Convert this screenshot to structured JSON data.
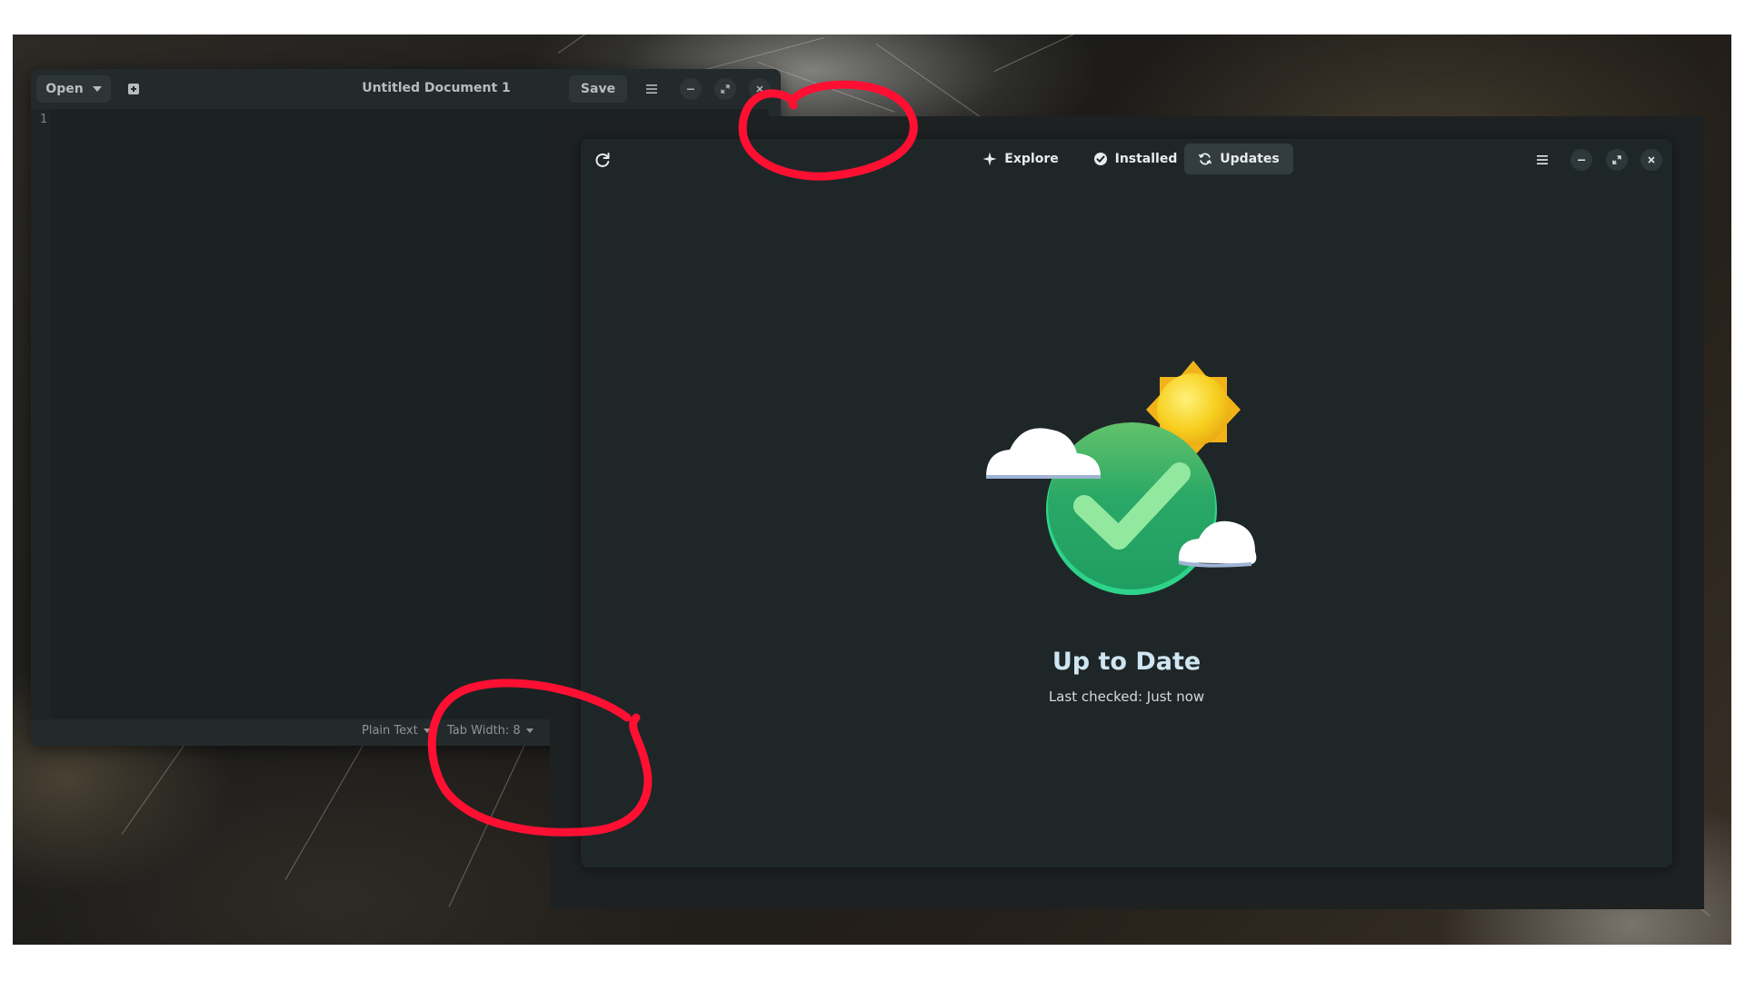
{
  "editor": {
    "open_label": "Open",
    "title": "Untitled Document 1",
    "save_label": "Save",
    "line_number": "1",
    "language": "Plain Text",
    "tab_width": "Tab Width: 8"
  },
  "updater": {
    "tabs": [
      {
        "label": "Explore",
        "icon": "sparkle-icon"
      },
      {
        "label": "Installed",
        "icon": "check-circle-icon"
      },
      {
        "label": "Updates",
        "icon": "sync-icon",
        "active": true
      }
    ],
    "status_title": "Up to Date",
    "status_subtitle": "Last checked: Just now"
  },
  "colors": {
    "annotation": "#ff1033",
    "check_green": "#2aa866",
    "sun_yellow": "#f5c518"
  }
}
